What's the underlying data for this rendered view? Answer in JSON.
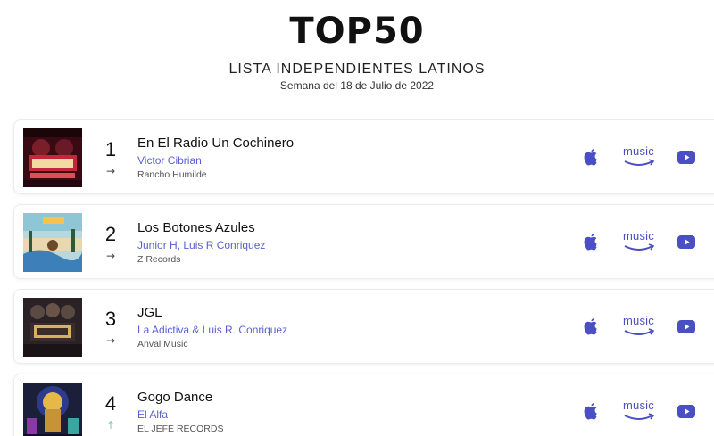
{
  "header": {
    "title": "TOP50",
    "subtitle": "LISTA INDEPENDIENTES LATINOS",
    "week": "Semana del 18 de Julio de 2022"
  },
  "colors": {
    "accent": "#5a5fd0",
    "icon": "#4b4fc4",
    "trend_up": "#7fc8b8"
  },
  "entries": [
    {
      "rank": "1",
      "trend": "→",
      "trend_icon": "arrow-right-icon",
      "song": "En El Radio Un Cochinero",
      "artist": "Victor Cibrian",
      "label": "Rancho Humilde"
    },
    {
      "rank": "2",
      "trend": "→",
      "trend_icon": "arrow-right-icon",
      "song": "Los Botones Azules",
      "artist": "Junior H, Luis R Conriquez",
      "label": "Z Records"
    },
    {
      "rank": "3",
      "trend": "→",
      "trend_icon": "arrow-right-icon",
      "song": "JGL",
      "artist": "La Adictiva & Luis R. Conriquez",
      "label": "Anval Music"
    },
    {
      "rank": "4",
      "trend": "↑",
      "trend_icon": "arrow-up-icon",
      "song": "Gogo Dance",
      "artist": "El Alfa",
      "label": "EL JEFE RECORDS"
    }
  ],
  "services": {
    "apple_icon": "apple-music-icon",
    "amazon_word": "music",
    "amazon_icon": "amazon-music-icon",
    "youtube_icon": "youtube-icon"
  }
}
